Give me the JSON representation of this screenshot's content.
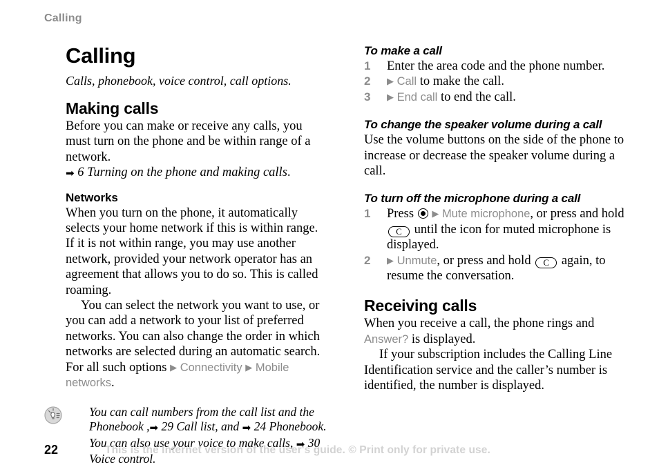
{
  "running_head": "Calling",
  "colors": {
    "menu_gray": "#8c8c8c",
    "header_gray": "#8c8c8c",
    "footer_gray": "#d2d2d2",
    "text_black": "#000000"
  },
  "left_column": {
    "title": "Calling",
    "subtitle": "Calls, phonebook, voice control, call options.",
    "making_calls": {
      "heading": "Making calls",
      "paragraph": "Before you can make or receive any calls, you must turn on the phone and be within range of a network.",
      "cross_reference": {
        "arrow": "➡",
        "text": "6 Turning on the phone and making calls",
        "trailing": "."
      }
    },
    "networks": {
      "heading": "Networks",
      "paragraph_1": "When you turn on the phone, it automatically selects your home network if this is within range. If it is not within range, you may use another network, provided your network operator has an agreement that allows you to do so. This is called roaming.",
      "paragraph_2_lead": "You can select the network you want to use, or you can add a network to your list of preferred networks. You can also change the order in which networks are selected during an automatic search. For all such options",
      "menu_path": {
        "triangle": "▶",
        "item_1": "Connectivity",
        "item_2": "Mobile networks",
        "trailing": "."
      }
    },
    "tip": {
      "icon": "lightbulb-tip-icon",
      "line_1": "You can call numbers from the call list and the Phonebook ,",
      "ref_1_arrow": "➡",
      "ref_1": "29 Call list",
      "conjunction": ", and",
      "ref_2_arrow": "➡",
      "ref_2": "24 Phonebook.",
      "line_2": "You can also use your voice to make calls,",
      "ref_3_arrow": "➡",
      "ref_3": "30 Voice control."
    }
  },
  "right_column": {
    "to_make_a_call": {
      "heading": "To make a call",
      "steps": [
        {
          "num": "1",
          "text": "Enter the area code and the phone number."
        },
        {
          "num": "2",
          "triangle": "▶",
          "menu": "Call",
          "text": "to make the call."
        },
        {
          "num": "3",
          "triangle": "▶",
          "menu": "End call",
          "text": "to end the call."
        }
      ]
    },
    "to_change_speaker_volume": {
      "heading": "To change the speaker volume during a call",
      "paragraph": "Use the volume buttons on the side of the phone to increase or decrease the speaker volume during a call."
    },
    "to_turn_off_microphone": {
      "heading": "To turn off the microphone during a call",
      "steps": [
        {
          "num": "1",
          "lead": "Press",
          "select_key": "selection-key-icon",
          "triangle": "▶",
          "menu": "Mute microphone",
          "mid": ", or press and hold",
          "key_label": "C",
          "tail": "until the icon for muted microphone is displayed."
        },
        {
          "num": "2",
          "triangle": "▶",
          "menu": "Unmute",
          "mid": ", or press and hold",
          "key_label": "C",
          "tail": "again, to resume the conversation."
        }
      ]
    },
    "receiving_calls": {
      "heading": "Receiving calls",
      "paragraph_1_lead": "When you receive a call, the phone rings and",
      "paragraph_1_menu": "Answer?",
      "paragraph_1_tail": "is displayed.",
      "paragraph_2": "If your subscription includes the Calling Line Identification service and the caller’s number is identified, the number is displayed."
    }
  },
  "footer": {
    "page_number": "22",
    "disclaimer": "This is the Internet version of the user's guide. © Print only for private use."
  }
}
